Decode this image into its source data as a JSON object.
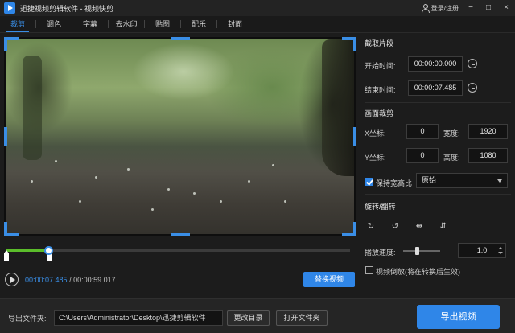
{
  "titlebar": {
    "app_name": "迅捷视频剪辑软件",
    "separator": " - ",
    "subtitle": "视频快剪",
    "login": "登录/注册",
    "minimize": "−",
    "maximize": "□",
    "close": "×"
  },
  "tabs": [
    "裁剪",
    "调色",
    "字幕",
    "去水印",
    "贴图",
    "配乐",
    "封面"
  ],
  "player": {
    "current_time": "00:00:07.485",
    "separator": " / ",
    "total_time": "00:00:59.017",
    "playhead_fraction": 0.127,
    "replace_label": "替换视频"
  },
  "clip": {
    "section_title": "截取片段",
    "start_label": "开始时间:",
    "start_value": "00:00:00.000",
    "end_label": "结束时间:",
    "end_value": "00:00:07.485"
  },
  "crop": {
    "section_title": "画面裁剪",
    "x_label": "X坐标:",
    "x_value": "0",
    "width_label": "宽度:",
    "width_value": "1920",
    "y_label": "Y坐标:",
    "y_value": "0",
    "height_label": "高度:",
    "height_value": "1080",
    "keep_ratio_label": "保持宽高比",
    "keep_ratio_checked": true,
    "ratio_selected": "原始"
  },
  "rotate": {
    "section_title": "旋转/翻转",
    "icons": [
      "rotate-right-icon",
      "rotate-left-icon",
      "flip-horizontal-icon",
      "flip-vertical-icon"
    ],
    "speed_label": "播放速度:",
    "speed_value": "1.0",
    "reverse_label": "视频倒放(将在转换后生效)",
    "reverse_checked": false
  },
  "output": {
    "label": "导出文件夹:",
    "path": "C:\\Users\\Administrator\\Desktop\\迅捷剪辑软件",
    "change_dir_label": "更改目录",
    "open_folder_label": "打开文件夹",
    "export_label": "导出视频"
  },
  "colors": {
    "accent": "#2f86e8",
    "progress": "#5bbd2b",
    "background": "#1c1c1c"
  }
}
